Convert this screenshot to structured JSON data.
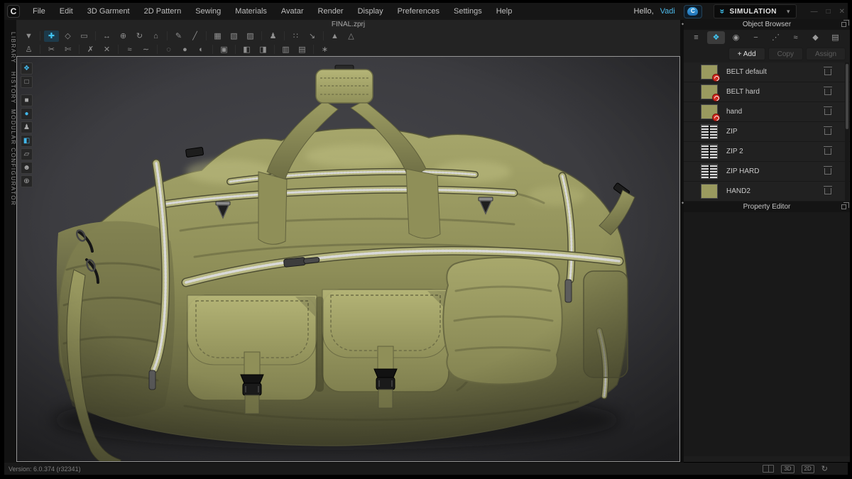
{
  "app": {
    "logo_letter": "C"
  },
  "menu_bar": {
    "items": [
      "File",
      "Edit",
      "3D Garment",
      "2D Pattern",
      "Sewing",
      "Materials",
      "Avatar",
      "Render",
      "Display",
      "Preferences",
      "Settings",
      "Help"
    ]
  },
  "top_right": {
    "greeting": "Hello,",
    "username": "Vadi",
    "cloud_letter": "C",
    "simulation": {
      "chevrons": "»",
      "label": "SIMULATION",
      "caret": "▾"
    },
    "window_controls": [
      {
        "name": "minimize-icon",
        "glyph": "—"
      },
      {
        "name": "restore-icon",
        "glyph": "□"
      },
      {
        "name": "close-icon",
        "glyph": "✕"
      }
    ]
  },
  "document": {
    "title": "FINAL.zprj"
  },
  "toolbar": {
    "row1": [
      {
        "name": "gizmo-drop-tool",
        "glyph": "▼"
      },
      {
        "sep": true
      },
      {
        "name": "move-tool",
        "glyph": "✚",
        "active": true
      },
      {
        "name": "transform-gizmo-tool",
        "glyph": "◇"
      },
      {
        "name": "rect-select-tool",
        "glyph": "▭"
      },
      {
        "sep": true
      },
      {
        "name": "pan-view-tool",
        "glyph": "↔"
      },
      {
        "name": "zoom-view-tool",
        "glyph": "⊕"
      },
      {
        "name": "rotate-view-tool",
        "glyph": "↻"
      },
      {
        "name": "reset-view-tool",
        "glyph": "⌂"
      },
      {
        "sep": true
      },
      {
        "name": "pen-tool",
        "glyph": "✎"
      },
      {
        "name": "line-tool",
        "glyph": "╱"
      },
      {
        "sep": true
      },
      {
        "name": "select-mesh-tool",
        "glyph": "▦"
      },
      {
        "name": "pattern-outline-tool",
        "glyph": "▧"
      },
      {
        "name": "pattern-flip-tool",
        "glyph": "▨"
      },
      {
        "sep": true
      },
      {
        "name": "avatar-tool",
        "glyph": "♟"
      },
      {
        "sep": true
      },
      {
        "name": "arrangement-points-tool",
        "glyph": "∷"
      },
      {
        "name": "measure-tool",
        "glyph": "↘"
      },
      {
        "sep": true
      },
      {
        "name": "fit-garment-tool",
        "glyph": "▲"
      },
      {
        "name": "fit-garment-alt-tool",
        "glyph": "△"
      }
    ],
    "row2": [
      {
        "name": "walk-avatar-tool",
        "glyph": "♙"
      },
      {
        "sep": true
      },
      {
        "name": "scissors-tool",
        "glyph": "✂"
      },
      {
        "name": "cut-sew-tool",
        "glyph": "✄"
      },
      {
        "sep": true
      },
      {
        "name": "sewing-edit-tool",
        "glyph": "✗"
      },
      {
        "name": "sewing-free-tool",
        "glyph": "✕"
      },
      {
        "sep": true
      },
      {
        "name": "segment-sewing-tool",
        "glyph": "≈"
      },
      {
        "name": "free-sewing-tool",
        "glyph": "∼"
      },
      {
        "sep": true
      },
      {
        "name": "detach-tool",
        "glyph": "◌"
      },
      {
        "name": "pin-tool",
        "glyph": "●"
      },
      {
        "name": "fold-tool",
        "glyph": "◐"
      },
      {
        "sep": true
      },
      {
        "name": "lock-pattern-tool",
        "glyph": "▣"
      },
      {
        "sep": true
      },
      {
        "name": "solidify-left-tool",
        "glyph": "◧"
      },
      {
        "name": "solidify-right-tool",
        "glyph": "◨"
      },
      {
        "sep": true
      },
      {
        "name": "quilt-h-tool",
        "glyph": "▥"
      },
      {
        "name": "quilt-v-tool",
        "glyph": "▤"
      },
      {
        "sep": true
      },
      {
        "name": "symmetry-tool",
        "glyph": "∗"
      }
    ]
  },
  "left_dock": {
    "tabs": [
      "LIBRARY",
      "HISTORY",
      "MODULAR CONFIGURATOR"
    ]
  },
  "viewport_strip": [
    {
      "name": "show-3d-garment-icon",
      "glyph": "❖",
      "cyan": true
    },
    {
      "name": "show-2d-pattern-icon",
      "glyph": "□"
    },
    {
      "gap": true
    },
    {
      "name": "garment-texture-icon",
      "glyph": "■"
    },
    {
      "name": "texture-sphere-icon",
      "glyph": "●",
      "cyan": true
    },
    {
      "name": "show-avatar-icon",
      "glyph": "♟"
    },
    {
      "name": "fabric-book-icon",
      "glyph": "◧",
      "cyan": true
    },
    {
      "name": "flat-view-icon",
      "glyph": "▱"
    },
    {
      "name": "portrait-view-icon",
      "glyph": "☻"
    },
    {
      "name": "environment-globe-icon",
      "glyph": "⊕"
    }
  ],
  "object_browser": {
    "title": "Object Browser",
    "tabs": [
      {
        "name": "scene-list-tab-icon",
        "glyph": "≡"
      },
      {
        "name": "fabric-tab-icon",
        "glyph": "❖",
        "active": true
      },
      {
        "name": "button-tab-icon",
        "glyph": "◉"
      },
      {
        "name": "buttonhole-tab-icon",
        "glyph": "−"
      },
      {
        "name": "topstitch-tab-icon",
        "glyph": "⋰"
      },
      {
        "name": "puckering-tab-icon",
        "glyph": "≈"
      },
      {
        "name": "trim-tab-icon",
        "glyph": "◆"
      },
      {
        "name": "zipper-tab-icon",
        "glyph": "▤"
      }
    ],
    "actions": {
      "add": "+ Add",
      "copy": "Copy",
      "assign": "Assign"
    },
    "items": [
      {
        "label": "BELT default",
        "thumb": "swatch",
        "badge": true
      },
      {
        "label": "BELT hard",
        "thumb": "swatch",
        "badge": true
      },
      {
        "label": "hand",
        "thumb": "swatch",
        "badge": true
      },
      {
        "label": "ZIP",
        "thumb": "zipper",
        "badge": false
      },
      {
        "label": "ZIP 2",
        "thumb": "zipper",
        "badge": false
      },
      {
        "label": "ZIP HARD",
        "thumb": "zipper",
        "badge": false
      },
      {
        "label": "HAND2",
        "thumb": "swatch",
        "badge": false
      }
    ]
  },
  "property_editor": {
    "title": "Property Editor"
  },
  "status_bar": {
    "version": "Version: 6.0.374 (r32341)",
    "toggle_3d": "3D",
    "toggle_2d": "2D",
    "sync_glyph": "↻"
  },
  "colors": {
    "accent_cyan": "#41c4f0",
    "username_blue": "#4db8e8",
    "olive_fabric": "#9a9a5f",
    "badge_red": "#d22a20",
    "viewport_bg": "#3c3c3f",
    "panel_bg": "#1d1d1d"
  }
}
